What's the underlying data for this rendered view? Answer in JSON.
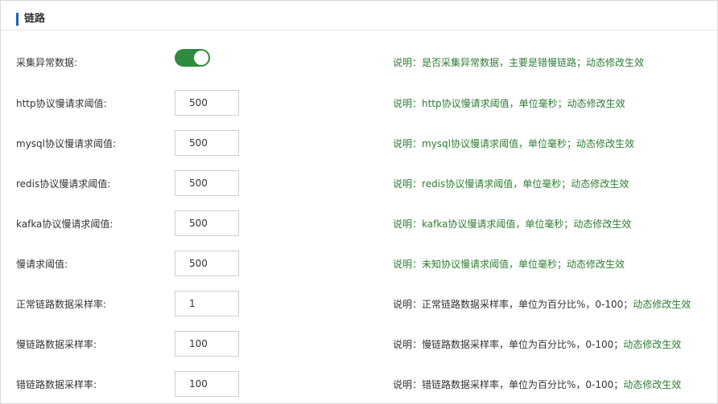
{
  "section": {
    "title": "链路"
  },
  "toggle_row": {
    "label": "采集异常数据:",
    "enabled": true,
    "desc": "说明：是否采集异常数据，主要是错慢链路；动态修改生效",
    "colors": {
      "on": "#2f8b3e"
    }
  },
  "rows": [
    {
      "label": "http协议慢请求阈值:",
      "value": "500",
      "desc_main": "说明：http协议慢请求阈值，单位毫秒；动态修改生效",
      "desc_note": ""
    },
    {
      "label": "mysql协议慢请求阈值:",
      "value": "500",
      "desc_main": "说明：mysql协议慢请求阈值，单位毫秒；动态修改生效",
      "desc_note": ""
    },
    {
      "label": "redis协议慢请求阈值:",
      "value": "500",
      "desc_main": "说明：redis协议慢请求阈值，单位毫秒；动态修改生效",
      "desc_note": ""
    },
    {
      "label": "kafka协议慢请求阈值:",
      "value": "500",
      "desc_main": "说明：kafka协议慢请求阈值，单位毫秒；动态修改生效",
      "desc_note": ""
    },
    {
      "label": "慢请求阈值:",
      "value": "500",
      "desc_main": "说明：未知协议慢请求阈值，单位毫秒；动态修改生效",
      "desc_note": ""
    },
    {
      "label": "正常链路数据采样率:",
      "value": "1",
      "desc_main": "说明：正常链路数据采样率，单位为百分比%，0-100；",
      "desc_note": "动态修改生效"
    },
    {
      "label": "慢链路数据采样率:",
      "value": "100",
      "desc_main": "说明：慢链路数据采样率，单位为百分比%，0-100；",
      "desc_note": "动态修改生效"
    },
    {
      "label": "错链路数据采样率:",
      "value": "100",
      "desc_main": "说明：错链路数据采样率，单位为百分比%，0-100；",
      "desc_note": "动态修改生效"
    }
  ],
  "colors": {
    "accent_bar": "#1e63b4",
    "desc_green": "#2e7d32"
  }
}
